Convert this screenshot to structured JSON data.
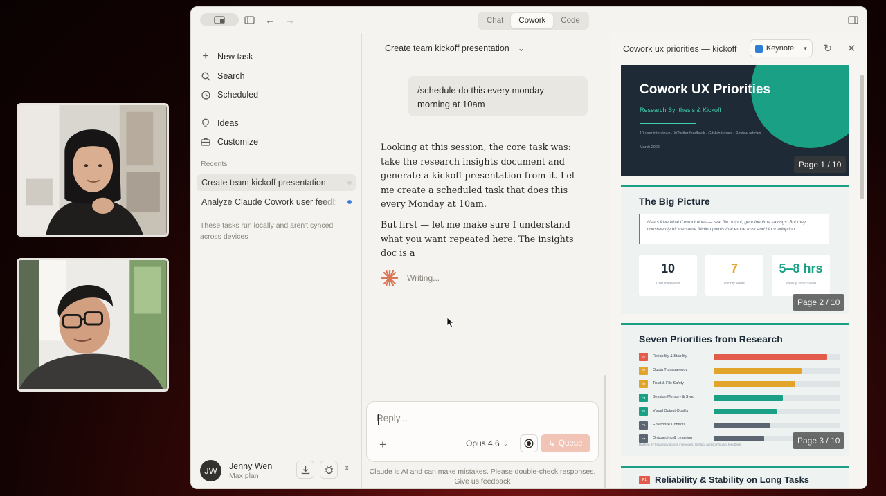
{
  "window": {
    "modes": [
      "Chat",
      "Cowork",
      "Code"
    ],
    "active_mode": "Cowork"
  },
  "sidebar": {
    "items": [
      {
        "label": "New task",
        "icon": "plus-icon"
      },
      {
        "label": "Search",
        "icon": "search-icon"
      },
      {
        "label": "Scheduled",
        "icon": "clock-icon"
      },
      {
        "label": "Ideas",
        "icon": "lightbulb-icon"
      },
      {
        "label": "Customize",
        "icon": "briefcase-icon"
      }
    ],
    "recents_title": "Recents",
    "recents": [
      {
        "label": "Create team kickoff presentation",
        "active": true
      },
      {
        "label": "Analyze Claude Cowork user feedback",
        "active": false
      }
    ],
    "note": "These tasks run locally and aren't synced across devices",
    "user": {
      "initials": "JW",
      "name": "Jenny Wen",
      "plan": "Max plan"
    }
  },
  "chat": {
    "title": "Create team kickoff presentation",
    "user_message": "/schedule do this every monday morning at 10am",
    "assistant_paragraphs": [
      "Looking at this session, the core task was: take the research insights document and generate a kickoff presentation from it. Let me create a scheduled task that does this every Monday at 10am.",
      "But first — let me make sure I understand what you want repeated here. The insights doc is a"
    ],
    "status": "Writing...",
    "composer": {
      "placeholder": "Reply...",
      "model": "Opus 4.6",
      "queue_label": "Queue"
    },
    "disclaimer": "Claude is AI and can make mistakes. Please double-check responses.",
    "feedback_link": "Give us feedback"
  },
  "preview": {
    "title": "Cowork ux priorities — kickoff",
    "export_label": "Keynote",
    "slides": {
      "s1": {
        "title": "Cowork UX Priorities",
        "subtitle": "Research Synthesis & Kickoff",
        "meta": "10 user interviews · X/Twitter feedback · GitHub issues · Review articles",
        "date": "March 2026",
        "page": "Page 1 / 10"
      },
      "s2": {
        "title": "The Big Picture",
        "quote": "Users love what Cowork does — real file output, genuine time savings. But they consistently hit the same friction points that erode trust and block adoption.",
        "stats": [
          {
            "value": "10",
            "label": "User Interviews",
            "color": "#1e2a36"
          },
          {
            "value": "7",
            "label": "Priority Areas",
            "color": "#e2a52b"
          },
          {
            "value": "5–8 hrs",
            "label": "Weekly Time Saved",
            "color": "#1aa085"
          }
        ],
        "page": "Page 2 / 10"
      },
      "s3": {
        "title": "Seven Priorities from Research",
        "priorities": [
          {
            "num": "P1",
            "label": "Reliability & Stability",
            "fraction": 0.9,
            "color": "#e35b4b"
          },
          {
            "num": "P2",
            "label": "Quota Transparency",
            "fraction": 0.7,
            "color": "#e2a52b"
          },
          {
            "num": "P3",
            "label": "Trust & File Safety",
            "fraction": 0.65,
            "color": "#e2a52b"
          },
          {
            "num": "P4",
            "label": "Session Memory & Sync",
            "fraction": 0.55,
            "color": "#1aa085"
          },
          {
            "num": "P5",
            "label": "Visual Output Quality",
            "fraction": 0.5,
            "color": "#1aa085"
          },
          {
            "num": "P6",
            "label": "Enterprise Controls",
            "fraction": 0.45,
            "color": "#5b6672"
          },
          {
            "num": "P7",
            "label": "Onboarding & Learning",
            "fraction": 0.4,
            "color": "#5b6672"
          }
        ],
        "footnote": "Ranked by frequency across interviews, GitHub, and community feedback",
        "page": "Page 3 / 10"
      },
      "s4": {
        "tag": "P1",
        "title": "Reliability & Stability on Long Tasks"
      }
    }
  },
  "colors": {
    "accent": "#d97757",
    "teal": "#1aa085",
    "slide_dark": "#1e2a36"
  }
}
